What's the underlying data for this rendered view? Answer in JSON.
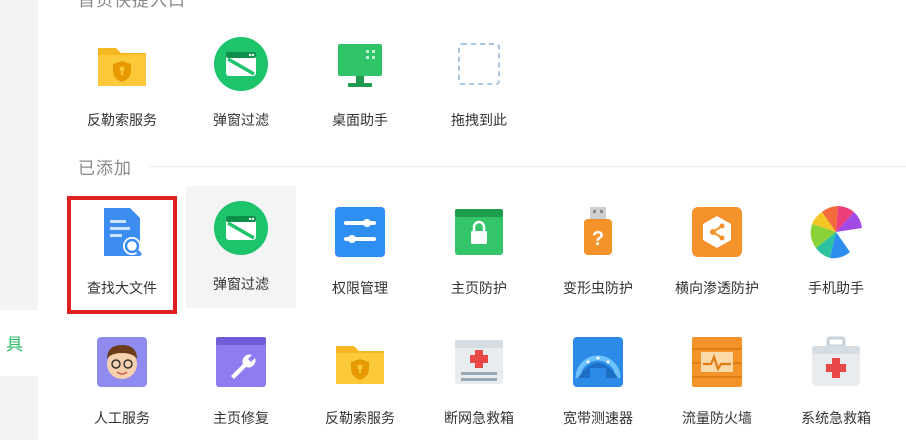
{
  "sidebar": {
    "partial_label": "具"
  },
  "top_section": {
    "title": "首页快捷入口",
    "items": [
      {
        "label": "反勒索服务",
        "icon": "shield-folder-icon"
      },
      {
        "label": "弹窗过滤",
        "icon": "popup-filter-icon"
      },
      {
        "label": "桌面助手",
        "icon": "desktop-assistant-icon"
      },
      {
        "label": "拖拽到此",
        "icon": "drop-target-icon"
      }
    ]
  },
  "added_section": {
    "title": "已添加",
    "row1": [
      {
        "label": "查找大文件",
        "icon": "find-large-file-icon"
      },
      {
        "label": "弹窗过滤",
        "icon": "popup-filter-icon"
      },
      {
        "label": "权限管理",
        "icon": "permission-toggle-icon"
      },
      {
        "label": "主页防护",
        "icon": "homepage-lock-icon"
      },
      {
        "label": "变形虫防护",
        "icon": "usb-question-icon"
      },
      {
        "label": "横向渗透防护",
        "icon": "network-shield-icon"
      },
      {
        "label": "手机助手",
        "icon": "colorful-fan-icon"
      }
    ],
    "row2": [
      {
        "label": "人工服务",
        "icon": "human-service-icon"
      },
      {
        "label": "主页修复",
        "icon": "wrench-repair-icon"
      },
      {
        "label": "反勒索服务",
        "icon": "shield-folder-icon"
      },
      {
        "label": "断网急救箱",
        "icon": "network-first-aid-icon"
      },
      {
        "label": "宽带测速器",
        "icon": "speedometer-icon"
      },
      {
        "label": "流量防火墙",
        "icon": "traffic-firewall-icon"
      },
      {
        "label": "系统急救箱",
        "icon": "system-first-aid-icon"
      }
    ]
  },
  "colors": {
    "highlight_border": "#e02020",
    "accent_green": "#2cbd6a"
  }
}
